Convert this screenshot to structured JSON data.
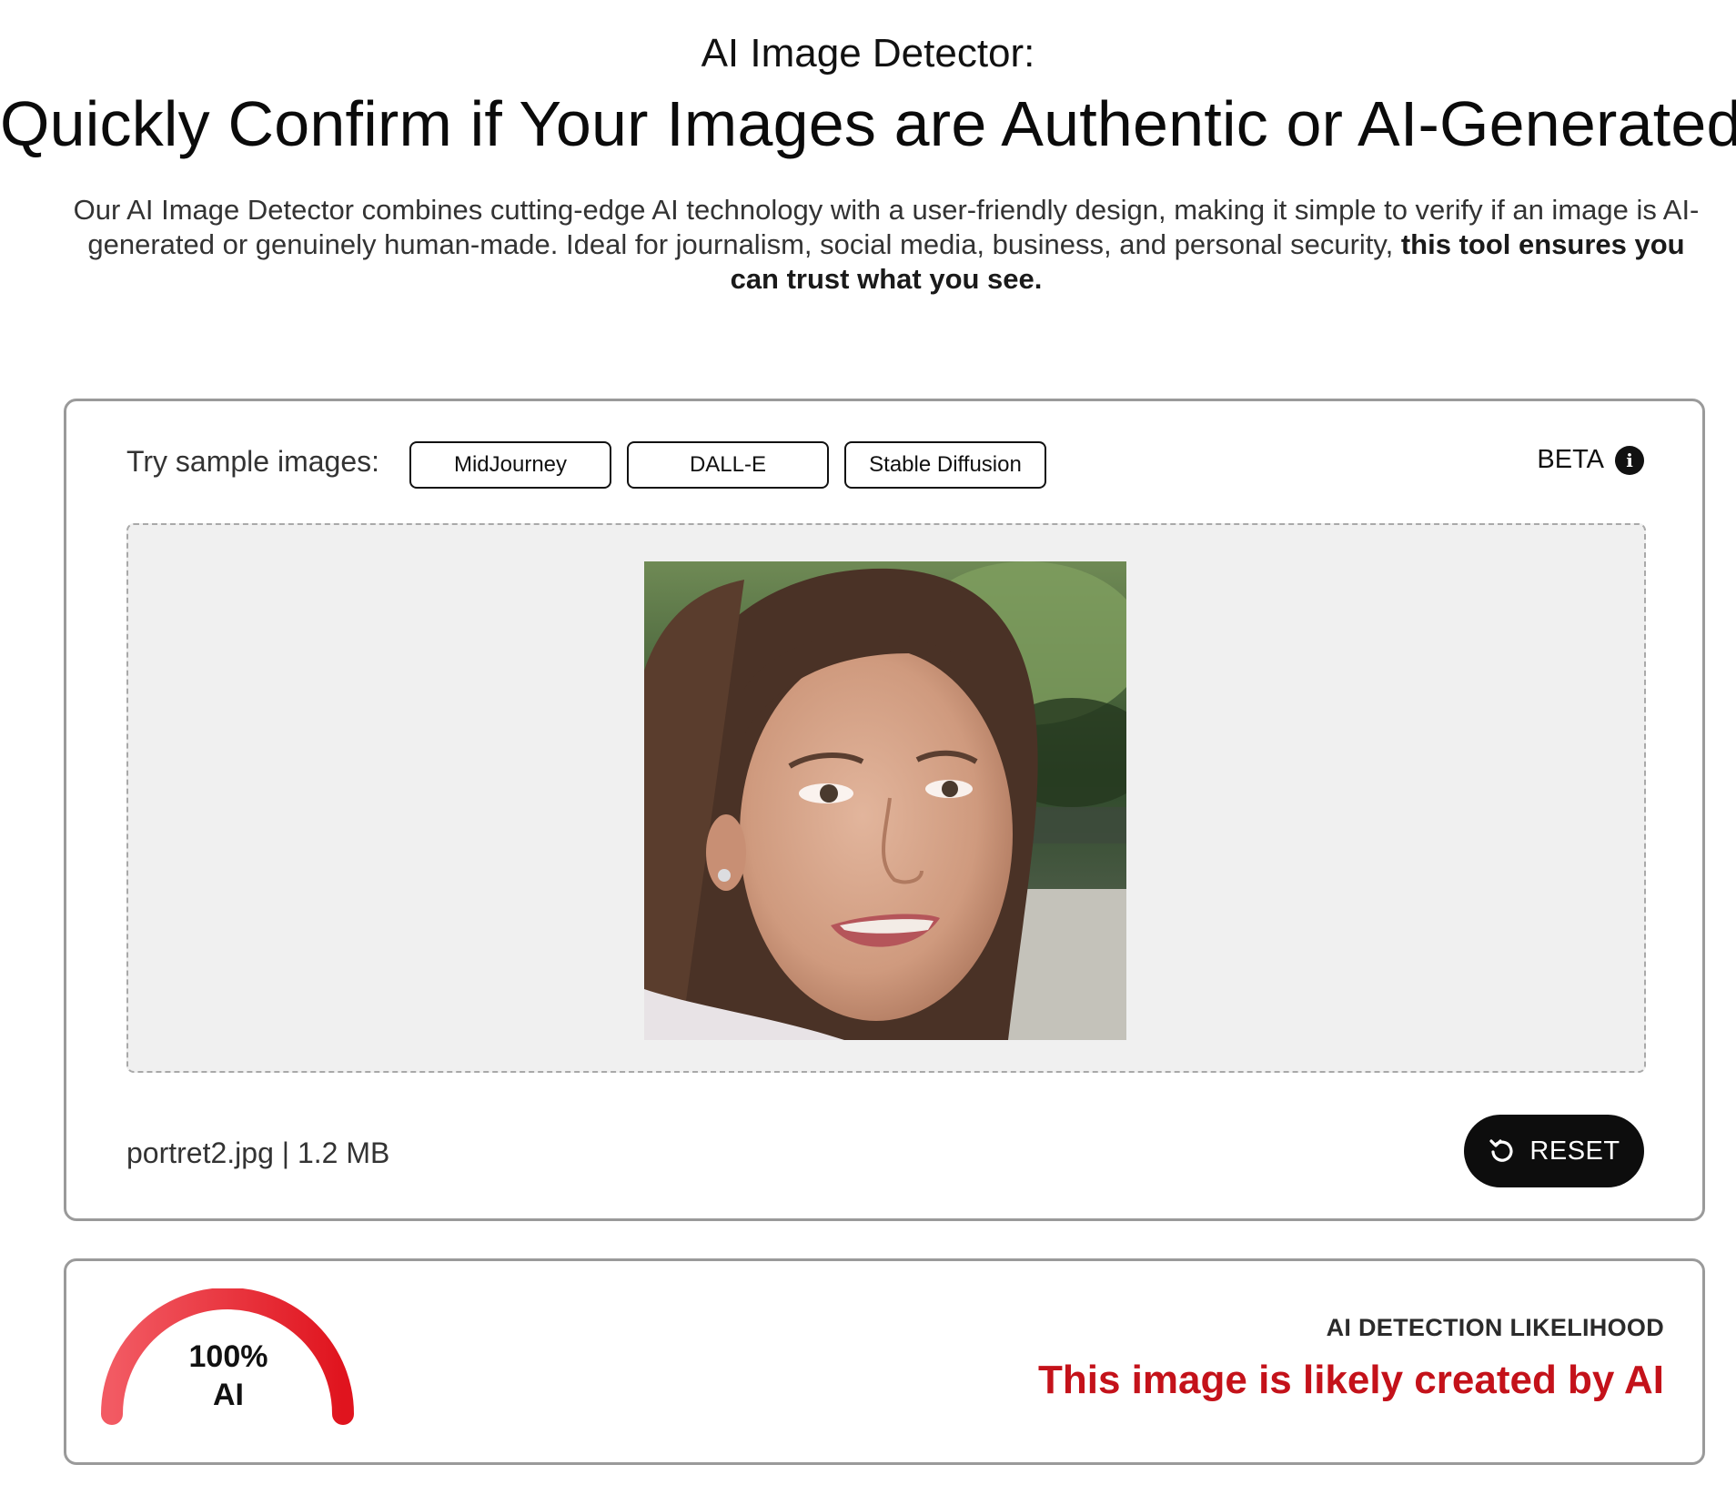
{
  "header": {
    "eyebrow": "AI Image Detector:",
    "headline": "Quickly Confirm if Your Images are Authentic or AI-Generated",
    "intro_plain": "Our AI Image Detector combines cutting-edge AI technology with a user-friendly design, making it simple to verify if an image is AI-generated or genuinely human-made. Ideal for journalism, social media, business, and personal security, ",
    "intro_bold": "this tool ensures you can trust what you see."
  },
  "upload": {
    "sample_label": "Try sample images:",
    "sample_buttons": [
      "MidJourney",
      "DALL-E",
      "Stable Diffusion"
    ],
    "beta_label": "BETA",
    "file_info": "portret2.jpg | 1.2 MB",
    "reset_label": "RESET"
  },
  "result": {
    "likelihood_percent": 100,
    "gauge_value": "100%",
    "gauge_unit": "AI",
    "likelihood_label": "AI DETECTION LIKELIHOOD",
    "verdict": "This image is likely created by AI"
  },
  "icons": {
    "info": "info-icon",
    "reset": "reset-icon"
  },
  "colors": {
    "verdict": "#c4121a",
    "gauge_start": "#f25a63",
    "gauge_end": "#e0141e",
    "button_dark": "#0d0d0d"
  }
}
